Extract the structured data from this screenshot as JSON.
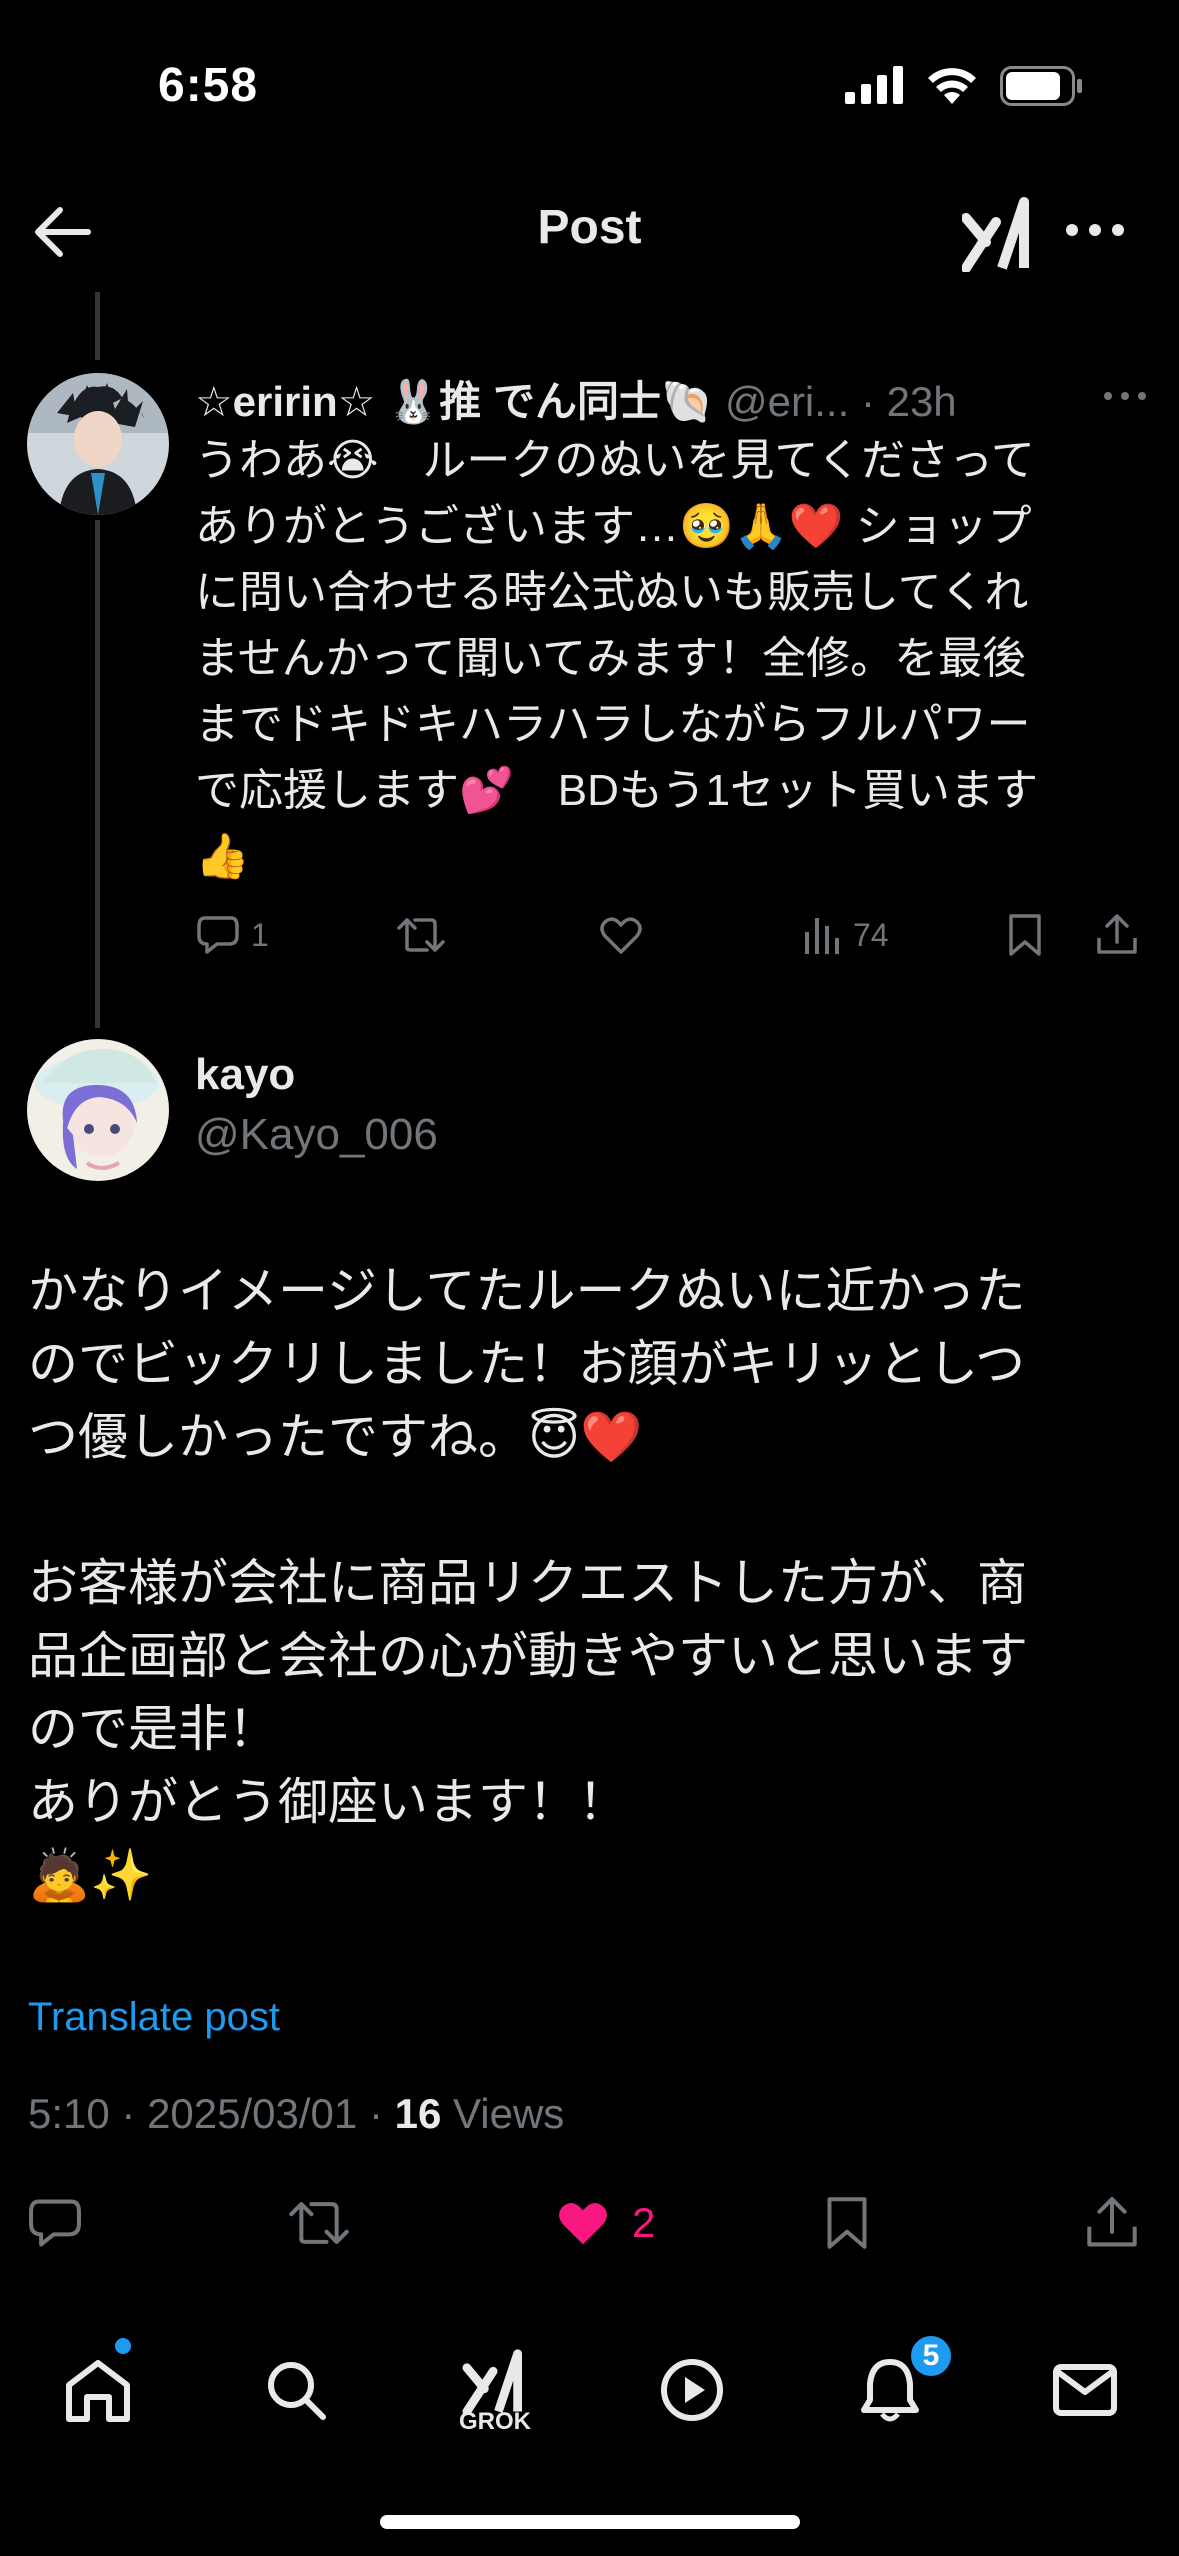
{
  "status_bar": {
    "time": "6:58"
  },
  "nav": {
    "title": "Post"
  },
  "reply": {
    "author_name": "☆eririn☆ 🐰推 でん同士🐚",
    "author_meta": " @eri... · 23h",
    "body": "うわあ😭　ルークのぬいを見てくださって\nありがとうございます…🥹🙏❤️ ショップ\nに問い合わせる時公式ぬいも販売してくれ\nませんかって聞いてみます！全修。を最後\nまでドキドキハラハラしながらフルパワー\nで応援します💕　BDもう1セット買います\n👍",
    "reply_count": "1",
    "views_count": "74"
  },
  "main_post": {
    "author_name": "kayo",
    "author_handle": "@Kayo_006",
    "body": "かなりイメージしてたルークぬいに近かった\nのでビックリしました！お顔がキリッとしつ\nつ優しかったですね。😇❤️\n\nお客様が会社に商品リクエストした方が、商\n品企画部と会社の心が動きやすいと思います\nので是非！\nありがとう御座います！！\n🙇✨",
    "translate_label": "Translate post",
    "meta_prefix": "5:10 · 2025/03/01 · ",
    "views_count": "16",
    "views_label": " Views",
    "like_count": "2"
  },
  "tab_bar": {
    "grok_label": "GROK",
    "notifications_badge": "5"
  },
  "colors": {
    "background": "#000000",
    "text_primary": "#e7e9ea",
    "text_secondary": "#71767b",
    "link": "#1d9bf0",
    "like": "#f91880"
  }
}
